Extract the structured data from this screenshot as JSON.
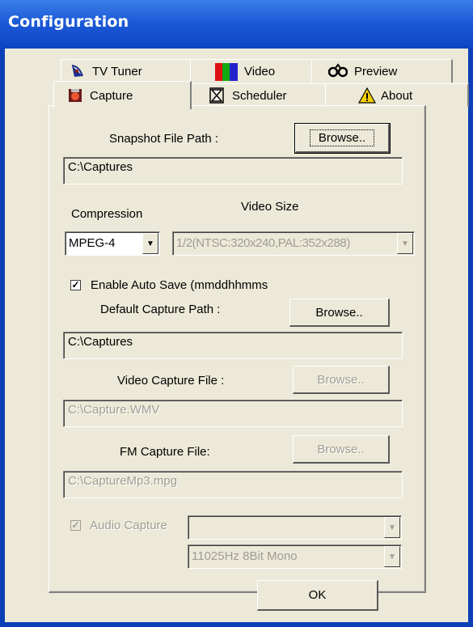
{
  "window": {
    "title": "Configuration"
  },
  "tabs": {
    "row_back": [
      {
        "label": "TV Tuner",
        "icon": "satellite-dish-icon"
      },
      {
        "label": "Video",
        "icon": "color-bars-icon"
      },
      {
        "label": "Preview",
        "icon": "glasses-icon"
      }
    ],
    "row_front": [
      {
        "label": "Capture",
        "icon": "capture-icon",
        "selected": true
      },
      {
        "label": "Scheduler",
        "icon": "hourglass-icon"
      },
      {
        "label": "About",
        "icon": "warning-icon"
      }
    ]
  },
  "snapshot": {
    "label": "Snapshot File Path :",
    "browse_label": "Browse..",
    "path": "C:\\Captures"
  },
  "compression": {
    "label": "Compression",
    "value": "MPEG-4"
  },
  "video_size": {
    "label": "Video Size",
    "value": "1/2(NTSC:320x240,PAL:352x288)"
  },
  "auto_save": {
    "checked": true,
    "label": "Enable Auto Save (mmddhhmms"
  },
  "default_capture": {
    "label": "Default Capture Path :",
    "browse_label": "Browse..",
    "path": "C:\\Captures"
  },
  "video_capture": {
    "label": "Video Capture File :",
    "browse_label": "Browse..",
    "path": "C:\\Capture.WMV"
  },
  "fm_capture": {
    "label": "FM Capture File:",
    "browse_label": "Browse..",
    "path": "C:\\CaptureMp3.mpg"
  },
  "audio_capture": {
    "checked": true,
    "label": "Audio Capture",
    "device": "",
    "format": "11025Hz 8Bit Mono"
  },
  "ok_label": "OK",
  "colors": {
    "title_bar": "#1c5ad8",
    "dialog_bg": "#ece9d8",
    "disabled_text": "#a09d92"
  }
}
